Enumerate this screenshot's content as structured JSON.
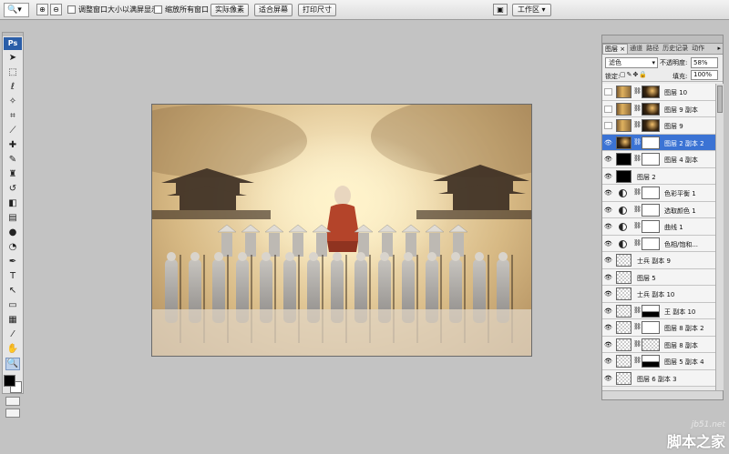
{
  "options_bar": {
    "tool_icon": "zoom-icon",
    "resize_window_label": "调整窗口大小以满屏显示",
    "zoom_all_label": "缩放所有窗口",
    "actual_pixels_label": "实际像素",
    "fit_screen_label": "适合屏幕",
    "print_size_label": "打印尺寸",
    "workspace_label": "工作区 ▾"
  },
  "toolbox": {
    "logo": "Ps",
    "tools": [
      "move-icon",
      "marquee-icon",
      "lasso-icon",
      "magic-wand-icon",
      "crop-icon",
      "slice-icon",
      "healing-icon",
      "brush-icon",
      "stamp-icon",
      "history-brush-icon",
      "eraser-icon",
      "gradient-icon",
      "blur-icon",
      "dodge-icon",
      "pen-icon",
      "type-icon",
      "path-select-icon",
      "shape-icon",
      "notes-icon",
      "eyedropper-icon",
      "hand-icon",
      "zoom-icon"
    ]
  },
  "layers_panel": {
    "tabs": [
      "图层 ×",
      "通道",
      "路径",
      "历史记录",
      "动作"
    ],
    "blend_mode": "滤色",
    "opacity_label": "不透明度:",
    "opacity_value": "58%",
    "lock_label": "锁定:",
    "fill_label": "填充:",
    "fill_value": "100%",
    "layers": [
      {
        "name": "图层 10",
        "visible": false,
        "kind": "photo",
        "mask": "dark",
        "selected": false
      },
      {
        "name": "图层 9 副本",
        "visible": false,
        "kind": "photo",
        "mask": "dark",
        "selected": false
      },
      {
        "name": "图层 9",
        "visible": false,
        "kind": "photo",
        "mask": "dark",
        "selected": false
      },
      {
        "name": "图层 2 副本 2",
        "visible": true,
        "kind": "darkphoto",
        "mask": "white",
        "selected": true
      },
      {
        "name": "图层 4 副本",
        "visible": true,
        "kind": "black",
        "mask": "white",
        "selected": false
      },
      {
        "name": "图层 2",
        "visible": true,
        "kind": "black",
        "mask": "",
        "selected": false
      },
      {
        "name": "色彩平衡 1",
        "visible": true,
        "kind": "adjust",
        "mask": "white",
        "selected": false
      },
      {
        "name": "选取颜色 1",
        "visible": true,
        "kind": "adjust",
        "mask": "white",
        "selected": false
      },
      {
        "name": "曲线 1",
        "visible": true,
        "kind": "adjust",
        "mask": "white",
        "selected": false
      },
      {
        "name": "色相/饱和...",
        "visible": true,
        "kind": "adjust",
        "mask": "white",
        "selected": false
      },
      {
        "name": "士兵 副本 9",
        "visible": true,
        "kind": "checker",
        "mask": "",
        "selected": false
      },
      {
        "name": "图层 5",
        "visible": true,
        "kind": "checker",
        "mask": "",
        "selected": false
      },
      {
        "name": "士兵 副本 10",
        "visible": true,
        "kind": "checker",
        "mask": "",
        "selected": false
      },
      {
        "name": "王 副本 10",
        "visible": true,
        "kind": "checker",
        "mask": "half",
        "selected": false
      },
      {
        "name": "图层 8 副本 2",
        "visible": true,
        "kind": "checker",
        "mask": "white",
        "selected": false
      },
      {
        "name": "图层 8 副本",
        "visible": true,
        "kind": "checker",
        "mask": "checker",
        "selected": false
      },
      {
        "name": "图层 5 副本 4",
        "visible": true,
        "kind": "checker",
        "mask": "half",
        "selected": false
      },
      {
        "name": "图层 6 副本 3",
        "visible": true,
        "kind": "checker",
        "mask": "",
        "selected": false
      }
    ]
  },
  "watermark": {
    "site": "jb51.net",
    "text": "脚本之家"
  },
  "colors": {
    "workspace_bg": "#c3c3c3",
    "selection": "#3b73d4"
  }
}
